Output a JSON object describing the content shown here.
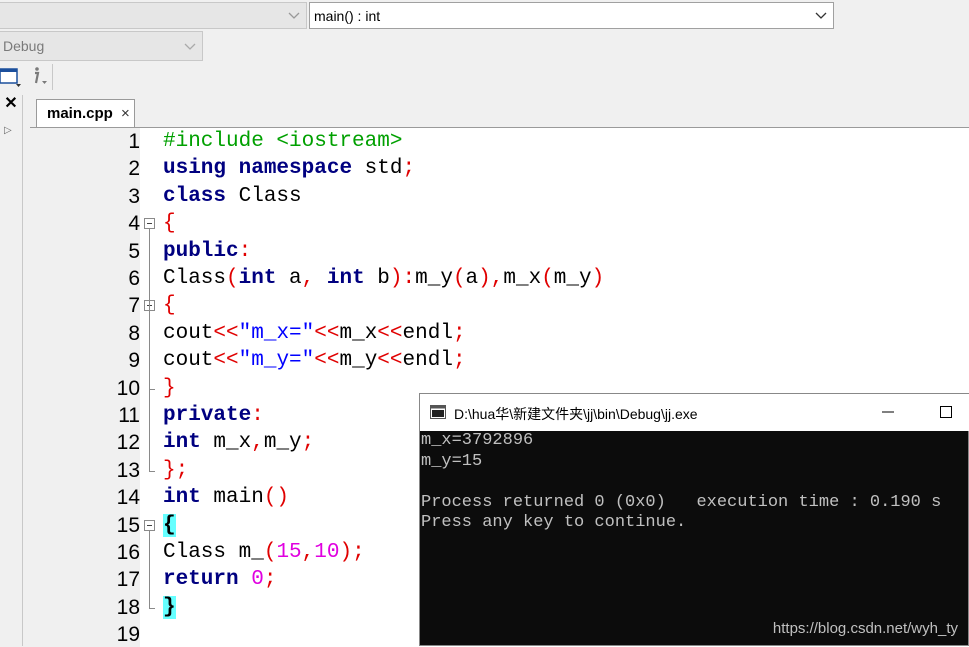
{
  "toolbar": {
    "scope_combo": "",
    "function_combo": "main() : int",
    "build_target": "Debug"
  },
  "editor": {
    "tab_label": "main.cpp",
    "tab_close": "×",
    "lines": [
      {
        "n": "1",
        "segments": [
          {
            "t": "#include <iostream>",
            "c": "pp"
          }
        ]
      },
      {
        "n": "2",
        "segments": [
          {
            "t": "using",
            "c": "kw"
          },
          {
            "t": " ",
            "c": ""
          },
          {
            "t": "namespace",
            "c": "kw"
          },
          {
            "t": " std",
            "c": ""
          },
          {
            "t": ";",
            "c": "op"
          }
        ]
      },
      {
        "n": "3",
        "segments": [
          {
            "t": "class",
            "c": "kw"
          },
          {
            "t": " Class",
            "c": ""
          }
        ]
      },
      {
        "n": "4",
        "segments": [
          {
            "t": "{",
            "c": "op"
          }
        ]
      },
      {
        "n": "5",
        "segments": [
          {
            "t": "public",
            "c": "kw"
          },
          {
            "t": ":",
            "c": "op"
          }
        ]
      },
      {
        "n": "6",
        "segments": [
          {
            "t": "Class",
            "c": ""
          },
          {
            "t": "(",
            "c": "op"
          },
          {
            "t": "int",
            "c": "kw"
          },
          {
            "t": " a",
            "c": ""
          },
          {
            "t": ",",
            "c": "op"
          },
          {
            "t": " ",
            "c": ""
          },
          {
            "t": "int",
            "c": "kw"
          },
          {
            "t": " b",
            "c": ""
          },
          {
            "t": "):",
            "c": "op"
          },
          {
            "t": "m_y",
            "c": ""
          },
          {
            "t": "(",
            "c": "op"
          },
          {
            "t": "a",
            "c": ""
          },
          {
            "t": "),",
            "c": "op"
          },
          {
            "t": "m_x",
            "c": ""
          },
          {
            "t": "(",
            "c": "op"
          },
          {
            "t": "m_y",
            "c": ""
          },
          {
            "t": ")",
            "c": "op"
          }
        ]
      },
      {
        "n": "7",
        "segments": [
          {
            "t": "{",
            "c": "op"
          }
        ]
      },
      {
        "n": "8",
        "segments": [
          {
            "t": "cout",
            "c": ""
          },
          {
            "t": "<<",
            "c": "op"
          },
          {
            "t": "\"m_x=\"",
            "c": "str"
          },
          {
            "t": "<<",
            "c": "op"
          },
          {
            "t": "m_x",
            "c": ""
          },
          {
            "t": "<<",
            "c": "op"
          },
          {
            "t": "endl",
            "c": ""
          },
          {
            "t": ";",
            "c": "op"
          }
        ]
      },
      {
        "n": "9",
        "segments": [
          {
            "t": "cout",
            "c": ""
          },
          {
            "t": "<<",
            "c": "op"
          },
          {
            "t": "\"m_y=\"",
            "c": "str"
          },
          {
            "t": "<<",
            "c": "op"
          },
          {
            "t": "m_y",
            "c": ""
          },
          {
            "t": "<<",
            "c": "op"
          },
          {
            "t": "endl",
            "c": ""
          },
          {
            "t": ";",
            "c": "op"
          }
        ]
      },
      {
        "n": "10",
        "segments": [
          {
            "t": "}",
            "c": "op"
          }
        ]
      },
      {
        "n": "11",
        "segments": [
          {
            "t": "private",
            "c": "kw"
          },
          {
            "t": ":",
            "c": "op"
          }
        ]
      },
      {
        "n": "12",
        "segments": [
          {
            "t": "int",
            "c": "kw"
          },
          {
            "t": " m_x",
            "c": ""
          },
          {
            "t": ",",
            "c": "op"
          },
          {
            "t": "m_y",
            "c": ""
          },
          {
            "t": ";",
            "c": "op"
          }
        ]
      },
      {
        "n": "13",
        "segments": [
          {
            "t": "};",
            "c": "op"
          }
        ]
      },
      {
        "n": "14",
        "segments": [
          {
            "t": "int",
            "c": "kw"
          },
          {
            "t": " main",
            "c": ""
          },
          {
            "t": "()",
            "c": "op"
          }
        ]
      },
      {
        "n": "15",
        "segments": [
          {
            "t": "{",
            "c": "brace-hl"
          }
        ]
      },
      {
        "n": "16",
        "segments": [
          {
            "t": "Class m_",
            "c": ""
          },
          {
            "t": "(",
            "c": "op"
          },
          {
            "t": "15",
            "c": "num"
          },
          {
            "t": ",",
            "c": "op"
          },
          {
            "t": "10",
            "c": "num"
          },
          {
            "t": ");",
            "c": "op"
          }
        ]
      },
      {
        "n": "17",
        "segments": [
          {
            "t": "return",
            "c": "kw"
          },
          {
            "t": " ",
            "c": ""
          },
          {
            "t": "0",
            "c": "num"
          },
          {
            "t": ";",
            "c": "op"
          }
        ]
      },
      {
        "n": "18",
        "segments": [
          {
            "t": "}",
            "c": "brace-hl"
          }
        ]
      },
      {
        "n": "19",
        "segments": []
      }
    ]
  },
  "console": {
    "title": "D:\\hua华\\新建文件夹\\jj\\bin\\Debug\\jj.exe",
    "output": [
      "m_x=3792896",
      "m_y=15",
      "",
      "Process returned 0 (0x0)   execution time : 0.190 s",
      "Press any key to continue."
    ],
    "watermark": "https://blog.csdn.net/wyh_ty"
  },
  "colors": {
    "preprocessor": "#00a000",
    "keyword": "#000080",
    "operator": "#e00000",
    "string": "#0000ff",
    "number": "#e000e0",
    "brace_match": "#66ffff",
    "console_bg": "#0c0c0c"
  }
}
